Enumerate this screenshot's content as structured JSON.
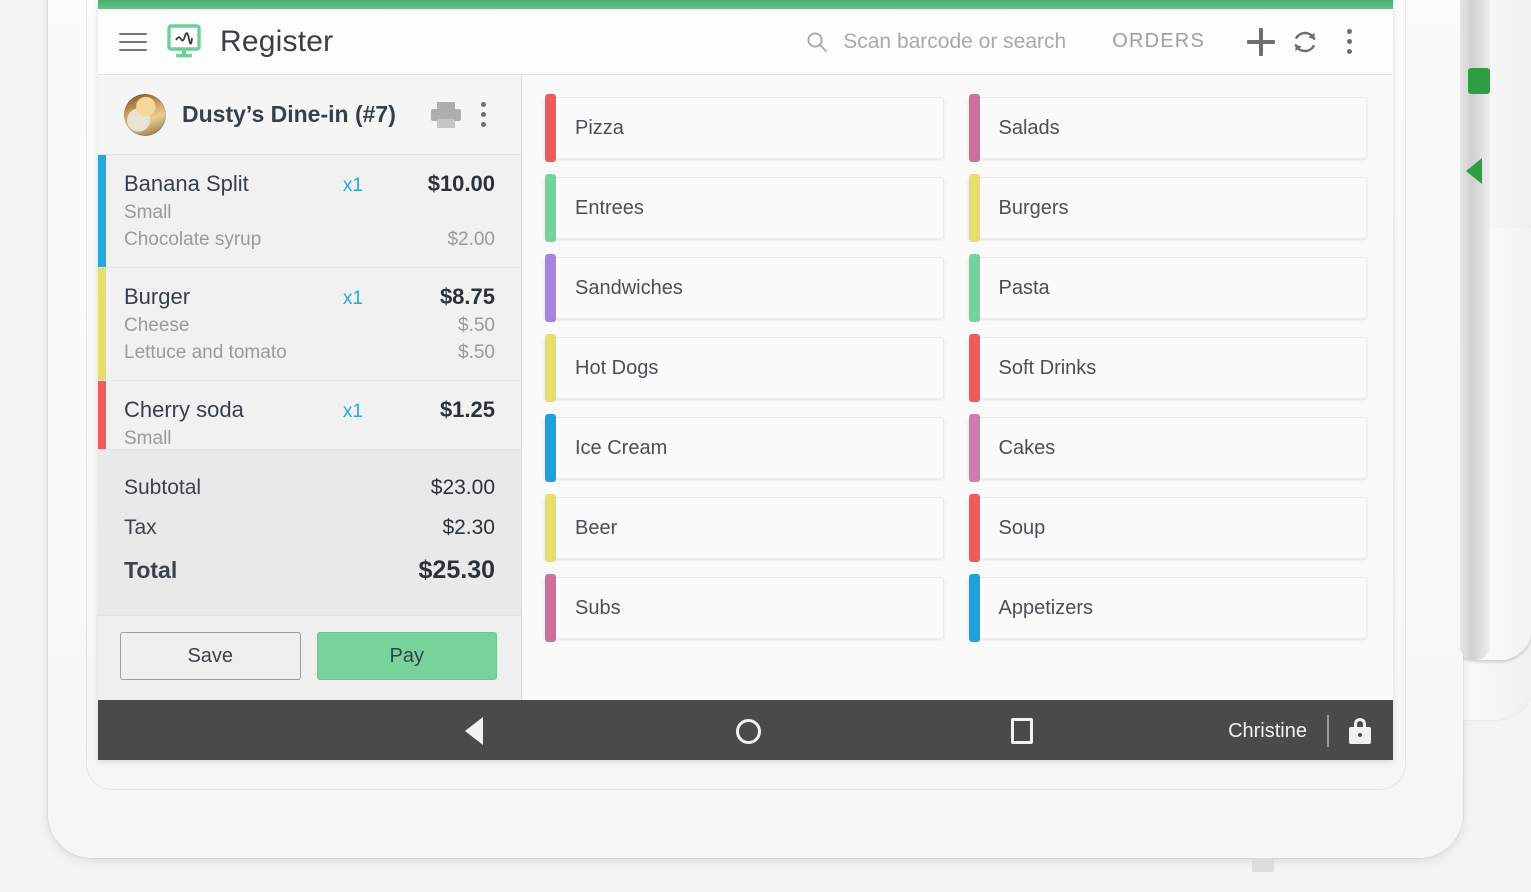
{
  "appbar": {
    "menu_icon": "hamburger-menu-icon",
    "logo_icon": "register-app-icon",
    "title": "Register",
    "search": {
      "icon": "search-icon",
      "placeholder": "Scan barcode or search",
      "value": ""
    },
    "orders_label": "ORDERS",
    "add_icon": "plus-icon",
    "refresh_icon": "refresh-icon",
    "overflow_icon": "kebab-menu-icon"
  },
  "order": {
    "avatar_icon": "user-avatar",
    "title": "Dusty’s Dine-in (#7)",
    "print_icon": "printer-icon",
    "overflow_icon": "kebab-menu-icon",
    "items": [
      {
        "name": "Banana Split",
        "qty": "x1",
        "price": "$10.00",
        "accent": "#29a8dc",
        "modifiers": [
          {
            "name": "Small",
            "price": ""
          },
          {
            "name": "Chocolate syrup",
            "price": "$2.00"
          }
        ]
      },
      {
        "name": "Burger",
        "qty": "x1",
        "price": "$8.75",
        "accent": "#e8dc6a",
        "modifiers": [
          {
            "name": "Cheese",
            "price": "$.50"
          },
          {
            "name": "Lettuce and tomato",
            "price": "$.50"
          }
        ]
      },
      {
        "name": "Cherry soda",
        "qty": "x1",
        "price": "$1.25",
        "accent": "#ef5a5a",
        "modifiers": [
          {
            "name": "Small",
            "price": ""
          }
        ]
      }
    ],
    "totals": [
      {
        "label": "Subtotal",
        "value": "$23.00",
        "grand": false
      },
      {
        "label": "Tax",
        "value": "$2.30",
        "grand": false
      },
      {
        "label": "Total",
        "value": "$25.30",
        "grand": true
      }
    ],
    "save_label": "Save",
    "pay_label": "Pay"
  },
  "menu": {
    "tiles": [
      {
        "label": "Pizza",
        "accent": "#ef5a5a"
      },
      {
        "label": "Salads",
        "accent": "#cf6f9e"
      },
      {
        "label": "Entrees",
        "accent": "#72d49c"
      },
      {
        "label": "Burgers",
        "accent": "#e8dc6a"
      },
      {
        "label": "Sandwiches",
        "accent": "#a583e0"
      },
      {
        "label": "Pasta",
        "accent": "#72d49c"
      },
      {
        "label": "Hot Dogs",
        "accent": "#e8dc6a"
      },
      {
        "label": "Soft Drinks",
        "accent": "#ef5a5a"
      },
      {
        "label": "Ice Cream",
        "accent": "#1ba3dd"
      },
      {
        "label": "Cakes",
        "accent": "#cf7bab"
      },
      {
        "label": "Beer",
        "accent": "#e8dc6a"
      },
      {
        "label": "Soup",
        "accent": "#ef5a5a"
      },
      {
        "label": "Subs",
        "accent": "#cf6f9e"
      },
      {
        "label": "Appetizers",
        "accent": "#1ba3dd"
      }
    ]
  },
  "navbar": {
    "back_icon": "back-triangle-icon",
    "home_icon": "home-circle-icon",
    "recents_icon": "recents-square-icon",
    "user": "Christine",
    "lock_icon": "lock-icon"
  },
  "colors": {
    "brand_green": "#67c187",
    "pay_green": "#77d39a",
    "qty_blue": "#29a8dc",
    "navbar": "#4a4a4a"
  }
}
